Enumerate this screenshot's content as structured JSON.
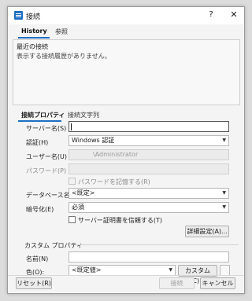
{
  "window": {
    "title": "接続",
    "help": "?",
    "close": "✕"
  },
  "tabs_top": {
    "history": "History",
    "browse": "参照"
  },
  "recent": {
    "title": "最近の接続",
    "empty": "表示する接続履歴がありません。"
  },
  "tabs_bottom": {
    "props": "接続プロパティ",
    "connstr": "接続文字列"
  },
  "form": {
    "server_label": "サーバー名(S)",
    "server_value": "",
    "auth_label": "認証(H)",
    "auth_value": "Windows 認証",
    "user_label": "ユーザー名(U)",
    "user_value": "\\Administrator",
    "password_label": "パスワード(P)",
    "remember_label": "パスワードを記憶する(R)",
    "database_label": "データベース名(D)",
    "database_value": "<既定>",
    "encrypt_label": "暗号化(E)",
    "encrypt_value": "必須",
    "trust_label": "サーバー証明書を信頼する(T)",
    "advanced_button": "詳細設定(A)..."
  },
  "custom": {
    "section_label": "カスタム プロパティ",
    "name_label": "名前(N)",
    "name_value": "",
    "color_label": "色(O):",
    "color_value": "<既定値>",
    "custom_button": "カスタム(C)..."
  },
  "footer": {
    "reset": "リセット(R)",
    "connect": "接続",
    "cancel": "キャンセル"
  },
  "colors": {
    "accent": "#1e6fc4"
  }
}
